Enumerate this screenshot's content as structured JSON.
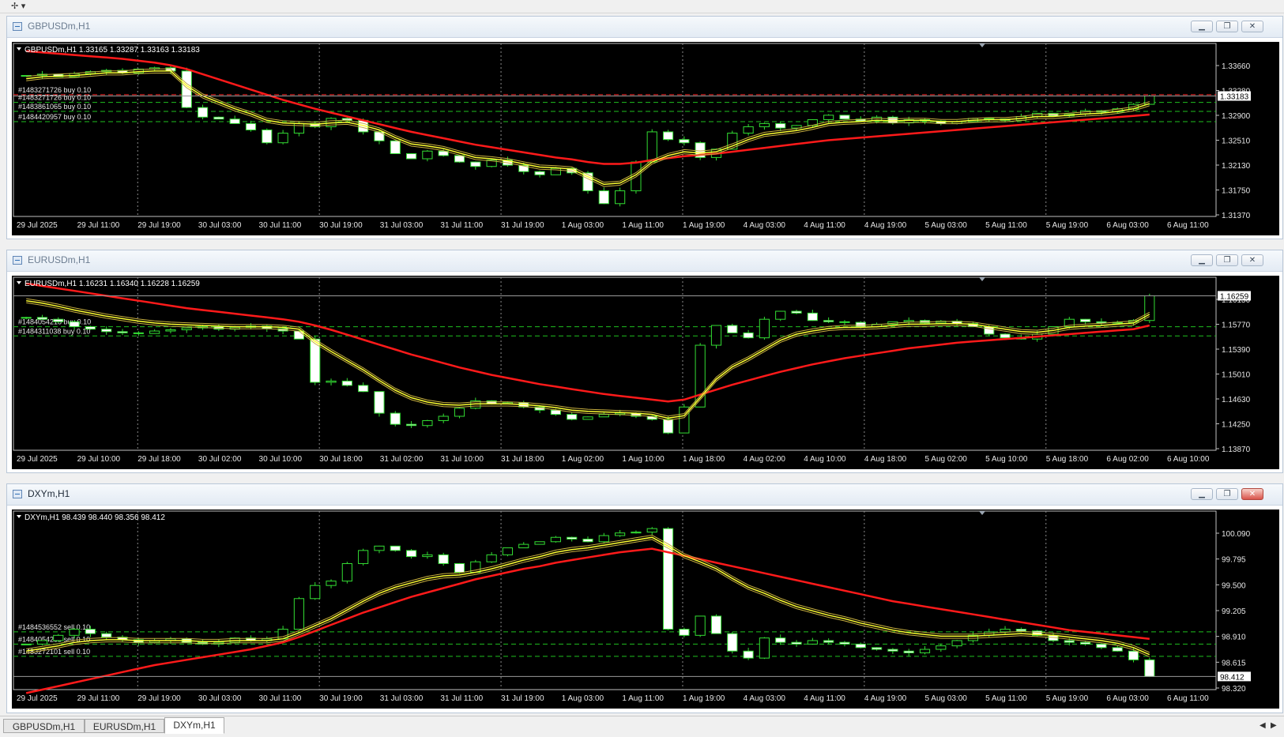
{
  "toolbar": {
    "icon": "crosshair-tool-icon"
  },
  "windows": [
    {
      "title": "GBPUSDm,H1",
      "active": false,
      "header": "GBPUSDm,H1  1.33165 1.33287 1.33163 1.33183",
      "last_price": "1.33183",
      "orders": [
        "#1483271726 buy 0.10",
        "#1483271726 buy 0.10",
        "#1483861065 buy 0.10",
        "#1484420957 buy 0.10"
      ],
      "price_ticks": [
        "1.33660",
        "1.33280",
        "1.32900",
        "1.32510",
        "1.32130",
        "1.31750",
        "1.31370"
      ],
      "time_ticks": [
        "29 Jul 2025",
        "29 Jul 11:00",
        "29 Jul 19:00",
        "30 Jul 03:00",
        "30 Jul 11:00",
        "30 Jul 19:00",
        "31 Jul 03:00",
        "31 Jul 11:00",
        "31 Jul 19:00",
        "1 Aug 03:00",
        "1 Aug 11:00",
        "1 Aug 19:00",
        "4 Aug 03:00",
        "4 Aug 11:00",
        "4 Aug 19:00",
        "5 Aug 03:00",
        "5 Aug 11:00",
        "5 Aug 19:00",
        "6 Aug 03:00",
        "6 Aug 11:00"
      ]
    },
    {
      "title": "EURUSDm,H1",
      "active": false,
      "header": "EURUSDm,H1  1.16231 1.16340 1.16228 1.16259",
      "last_price": "1.16259",
      "orders": [
        "#1484054218 buy 0.10",
        "#1484311038 buy 0.10"
      ],
      "price_ticks": [
        "1.16150",
        "1.15770",
        "1.15390",
        "1.15010",
        "1.14630",
        "1.14250",
        "1.13870"
      ],
      "time_ticks": [
        "29 Jul 2025",
        "29 Jul 10:00",
        "29 Jul 18:00",
        "30 Jul 02:00",
        "30 Jul 10:00",
        "30 Jul 18:00",
        "31 Jul 02:00",
        "31 Jul 10:00",
        "31 Jul 18:00",
        "1 Aug 02:00",
        "1 Aug 10:00",
        "1 Aug 18:00",
        "4 Aug 02:00",
        "4 Aug 10:00",
        "4 Aug 18:00",
        "5 Aug 02:00",
        "5 Aug 10:00",
        "5 Aug 18:00",
        "6 Aug 02:00",
        "6 Aug 10:00"
      ]
    },
    {
      "title": "DXYm,H1",
      "active": true,
      "header": "DXYm,H1  98.439 98.440 98.356 98.412",
      "last_price": "98.412",
      "orders": [
        "#1484536552 sell 0.10",
        "#1484054258 sell 0.10",
        "#1483272101 sell 0.10"
      ],
      "price_ticks": [
        "100.090",
        "99.795",
        "99.500",
        "99.205",
        "98.910",
        "98.615",
        "98.320"
      ],
      "time_ticks": [
        "29 Jul 2025",
        "29 Jul 11:00",
        "29 Jul 19:00",
        "30 Jul 03:00",
        "30 Jul 11:00",
        "30 Jul 19:00",
        "31 Jul 03:00",
        "31 Jul 11:00",
        "31 Jul 19:00",
        "1 Aug 03:00",
        "1 Aug 11:00",
        "1 Aug 19:00",
        "4 Aug 03:00",
        "4 Aug 11:00",
        "4 Aug 19:00",
        "5 Aug 03:00",
        "5 Aug 11:00",
        "5 Aug 19:00",
        "6 Aug 03:00",
        "6 Aug 11:00"
      ]
    }
  ],
  "chart_data": [
    {
      "type": "candlestick",
      "symbol": "GBPUSDm,H1",
      "ylim": [
        1.313,
        1.34
      ],
      "order_levels": [
        1.332,
        1.3308,
        1.3294,
        1.3278
      ],
      "order_colors": [
        "#ff2a2a",
        "#1fbf1f",
        "#1fbf1f",
        "#1fbf1f"
      ],
      "close_path": [
        1.335,
        1.3352,
        1.3348,
        1.3353,
        1.3356,
        1.3358,
        1.3354,
        1.336,
        1.3362,
        1.3357,
        1.33,
        1.3285,
        1.3282,
        1.3275,
        1.3265,
        1.3245,
        1.326,
        1.3275,
        1.327,
        1.3283,
        1.328,
        1.3262,
        1.3248,
        1.3228,
        1.322,
        1.3232,
        1.3225,
        1.3215,
        1.3208,
        1.3218,
        1.321,
        1.32,
        1.3195,
        1.3205,
        1.3198,
        1.317,
        1.315,
        1.317,
        1.3215,
        1.3262,
        1.325,
        1.3245,
        1.3222,
        1.3235,
        1.326,
        1.327,
        1.3275,
        1.3268,
        1.3272,
        1.3281,
        1.3288,
        1.3282,
        1.3279,
        1.3285,
        1.3276,
        1.3281,
        1.3279,
        1.3275,
        1.3278,
        1.3283,
        1.3282,
        1.328,
        1.3286,
        1.3291,
        1.3287,
        1.329,
        1.3295,
        1.3293,
        1.3298,
        1.3305,
        1.3318
      ],
      "ema_fast": [
        1.3345,
        1.3348,
        1.3349,
        1.335,
        1.3352,
        1.3354,
        1.3354,
        1.3356,
        1.3357,
        1.3357,
        1.3334,
        1.3318,
        1.3308,
        1.3298,
        1.329,
        1.328,
        1.3276,
        1.3275,
        1.3274,
        1.3276,
        1.3277,
        1.3272,
        1.3265,
        1.3253,
        1.3243,
        1.324,
        1.3236,
        1.3229,
        1.3222,
        1.322,
        1.3217,
        1.3212,
        1.3207,
        1.3206,
        1.3204,
        1.3192,
        1.318,
        1.3182,
        1.3195,
        1.3215,
        1.3225,
        1.3231,
        1.3229,
        1.3231,
        1.324,
        1.325,
        1.3258,
        1.3261,
        1.3264,
        1.3269,
        1.3275,
        1.3277,
        1.3278,
        1.328,
        1.3279,
        1.328,
        1.328,
        1.3278,
        1.3278,
        1.328,
        1.3281,
        1.3281,
        1.3283,
        1.3286,
        1.3286,
        1.3288,
        1.329,
        1.3291,
        1.3294,
        1.3298,
        1.3306
      ],
      "ema_slow": [
        1.3388,
        1.3386,
        1.3384,
        1.3382,
        1.338,
        1.3378,
        1.3376,
        1.3373,
        1.337,
        1.3366,
        1.336,
        1.3352,
        1.3344,
        1.3336,
        1.3328,
        1.332,
        1.3312,
        1.3305,
        1.3298,
        1.3292,
        1.3286,
        1.328,
        1.3274,
        1.3268,
        1.3262,
        1.3257,
        1.3252,
        1.3247,
        1.3242,
        1.3238,
        1.3234,
        1.323,
        1.3226,
        1.3222,
        1.3219,
        1.3215,
        1.3212,
        1.3212,
        1.3214,
        1.3218,
        1.3221,
        1.3224,
        1.3226,
        1.3228,
        1.3231,
        1.3234,
        1.3237,
        1.324,
        1.3243,
        1.3246,
        1.3249,
        1.3251,
        1.3253,
        1.3255,
        1.3257,
        1.3259,
        1.3261,
        1.3263,
        1.3265,
        1.3267,
        1.3269,
        1.3271,
        1.3273,
        1.3275,
        1.3277,
        1.3279,
        1.3281,
        1.3283,
        1.3285,
        1.3287,
        1.3289
      ]
    },
    {
      "type": "candlestick",
      "symbol": "EURUSDm,H1",
      "ylim": [
        1.137,
        1.165
      ],
      "order_levels": [
        1.157,
        1.1555
      ],
      "order_colors": [
        "#1fbf1f",
        "#1fbf1f"
      ],
      "close_path": [
        1.1585,
        1.1582,
        1.1578,
        1.157,
        1.1566,
        1.1562,
        1.156,
        1.1559,
        1.1563,
        1.1565,
        1.1568,
        1.157,
        1.1566,
        1.1569,
        1.1571,
        1.1567,
        1.1563,
        1.155,
        1.148,
        1.1482,
        1.1475,
        1.1465,
        1.143,
        1.1412,
        1.141,
        1.1418,
        1.1425,
        1.1438,
        1.145,
        1.1445,
        1.1447,
        1.144,
        1.1435,
        1.1428,
        1.142,
        1.1424,
        1.1428,
        1.143,
        1.1425,
        1.142,
        1.1398,
        1.144,
        1.154,
        1.1572,
        1.156,
        1.1552,
        1.1582,
        1.1595,
        1.1592,
        1.158,
        1.1578,
        1.1577,
        1.157,
        1.1574,
        1.1578,
        1.158,
        1.1576,
        1.1579,
        1.1575,
        1.157,
        1.1558,
        1.1552,
        1.155,
        1.1558,
        1.157,
        1.1582,
        1.1578,
        1.1576,
        1.1577,
        1.158,
        1.162
      ],
      "ema_fast": [
        1.1612,
        1.1608,
        1.1603,
        1.1597,
        1.1592,
        1.1587,
        1.1583,
        1.1579,
        1.1576,
        1.1574,
        1.1573,
        1.1572,
        1.1571,
        1.157,
        1.157,
        1.157,
        1.1569,
        1.1566,
        1.1546,
        1.153,
        1.1515,
        1.15,
        1.1483,
        1.1467,
        1.1455,
        1.1448,
        1.1444,
        1.1443,
        1.1445,
        1.1445,
        1.1445,
        1.1444,
        1.1442,
        1.1439,
        1.1435,
        1.1433,
        1.1432,
        1.1431,
        1.143,
        1.1428,
        1.1422,
        1.1426,
        1.1455,
        1.1485,
        1.1505,
        1.1518,
        1.1533,
        1.1548,
        1.1558,
        1.1563,
        1.1567,
        1.1569,
        1.1569,
        1.157,
        1.1572,
        1.1574,
        1.1574,
        1.1575,
        1.1575,
        1.1574,
        1.157,
        1.1566,
        1.1562,
        1.1561,
        1.1564,
        1.1569,
        1.1571,
        1.1572,
        1.1574,
        1.1576,
        1.159
      ],
      "ema_slow": [
        1.164,
        1.1636,
        1.1632,
        1.1628,
        1.1624,
        1.162,
        1.1616,
        1.1612,
        1.1608,
        1.1604,
        1.16,
        1.1597,
        1.1594,
        1.1591,
        1.1588,
        1.1585,
        1.1582,
        1.1578,
        1.1572,
        1.1565,
        1.1557,
        1.1549,
        1.1541,
        1.1533,
        1.1525,
        1.1518,
        1.1511,
        1.1504,
        1.1498,
        1.1492,
        1.1487,
        1.1482,
        1.1477,
        1.1473,
        1.1469,
        1.1465,
        1.1461,
        1.1458,
        1.1455,
        1.1452,
        1.1449,
        1.1452,
        1.146,
        1.1468,
        1.1476,
        1.1483,
        1.149,
        1.1497,
        1.1503,
        1.1509,
        1.1514,
        1.1519,
        1.1523,
        1.1527,
        1.1531,
        1.1535,
        1.1538,
        1.1541,
        1.1544,
        1.1546,
        1.1548,
        1.155,
        1.1552,
        1.1554,
        1.1556,
        1.1558,
        1.156,
        1.1562,
        1.1564,
        1.1566,
        1.1572
      ]
    },
    {
      "type": "candlestick",
      "symbol": "DXYm,H1",
      "ylim": [
        98.26,
        100.3
      ],
      "order_levels": [
        98.92,
        98.78,
        98.64
      ],
      "order_colors": [
        "#1fbf1f",
        "#1fbf1f",
        "#1fbf1f"
      ],
      "close_path": [
        98.78,
        98.82,
        98.88,
        98.95,
        98.9,
        98.86,
        98.83,
        98.8,
        98.82,
        98.84,
        98.8,
        98.78,
        98.8,
        98.85,
        98.82,
        98.84,
        98.95,
        99.3,
        99.45,
        99.5,
        99.7,
        99.85,
        99.9,
        99.85,
        99.78,
        99.8,
        99.7,
        99.6,
        99.72,
        99.8,
        99.88,
        99.92,
        99.95,
        100.0,
        99.98,
        99.95,
        100.02,
        100.05,
        100.06,
        100.1,
        98.95,
        98.88,
        99.1,
        98.9,
        98.7,
        98.62,
        98.85,
        98.8,
        98.78,
        98.82,
        98.8,
        98.78,
        98.74,
        98.72,
        98.7,
        98.68,
        98.72,
        98.76,
        98.82,
        98.88,
        98.92,
        98.95,
        98.93,
        98.88,
        98.82,
        98.8,
        98.78,
        98.74,
        98.7,
        98.6,
        98.41
      ],
      "ema_fast": [
        98.7,
        98.73,
        98.76,
        98.8,
        98.82,
        98.83,
        98.83,
        98.82,
        98.82,
        98.82,
        98.82,
        98.81,
        98.81,
        98.82,
        98.82,
        98.82,
        98.84,
        98.91,
        98.99,
        99.07,
        99.17,
        99.27,
        99.36,
        99.43,
        99.48,
        99.53,
        99.56,
        99.57,
        99.6,
        99.64,
        99.69,
        99.74,
        99.78,
        99.83,
        99.86,
        99.88,
        99.91,
        99.94,
        99.97,
        100.0,
        99.9,
        99.79,
        99.72,
        99.64,
        99.53,
        99.43,
        99.36,
        99.28,
        99.21,
        99.16,
        99.11,
        99.07,
        99.02,
        98.98,
        98.94,
        98.91,
        98.89,
        98.87,
        98.87,
        98.87,
        98.88,
        98.89,
        98.9,
        98.89,
        98.88,
        98.86,
        98.84,
        98.82,
        98.79,
        98.74,
        98.66
      ],
      "ema_slow": [
        98.22,
        98.26,
        98.3,
        98.34,
        98.38,
        98.42,
        98.46,
        98.5,
        98.54,
        98.57,
        98.6,
        98.63,
        98.66,
        98.69,
        98.72,
        98.76,
        98.8,
        98.86,
        98.93,
        99.0,
        99.07,
        99.14,
        99.2,
        99.26,
        99.32,
        99.37,
        99.42,
        99.47,
        99.52,
        99.56,
        99.6,
        99.64,
        99.67,
        99.71,
        99.74,
        99.77,
        99.8,
        99.83,
        99.85,
        99.87,
        99.83,
        99.79,
        99.75,
        99.71,
        99.67,
        99.63,
        99.59,
        99.55,
        99.51,
        99.47,
        99.43,
        99.39,
        99.35,
        99.31,
        99.27,
        99.24,
        99.21,
        99.18,
        99.15,
        99.12,
        99.09,
        99.06,
        99.03,
        99.0,
        98.97,
        98.94,
        98.92,
        98.9,
        98.88,
        98.86,
        98.84
      ]
    }
  ]
}
